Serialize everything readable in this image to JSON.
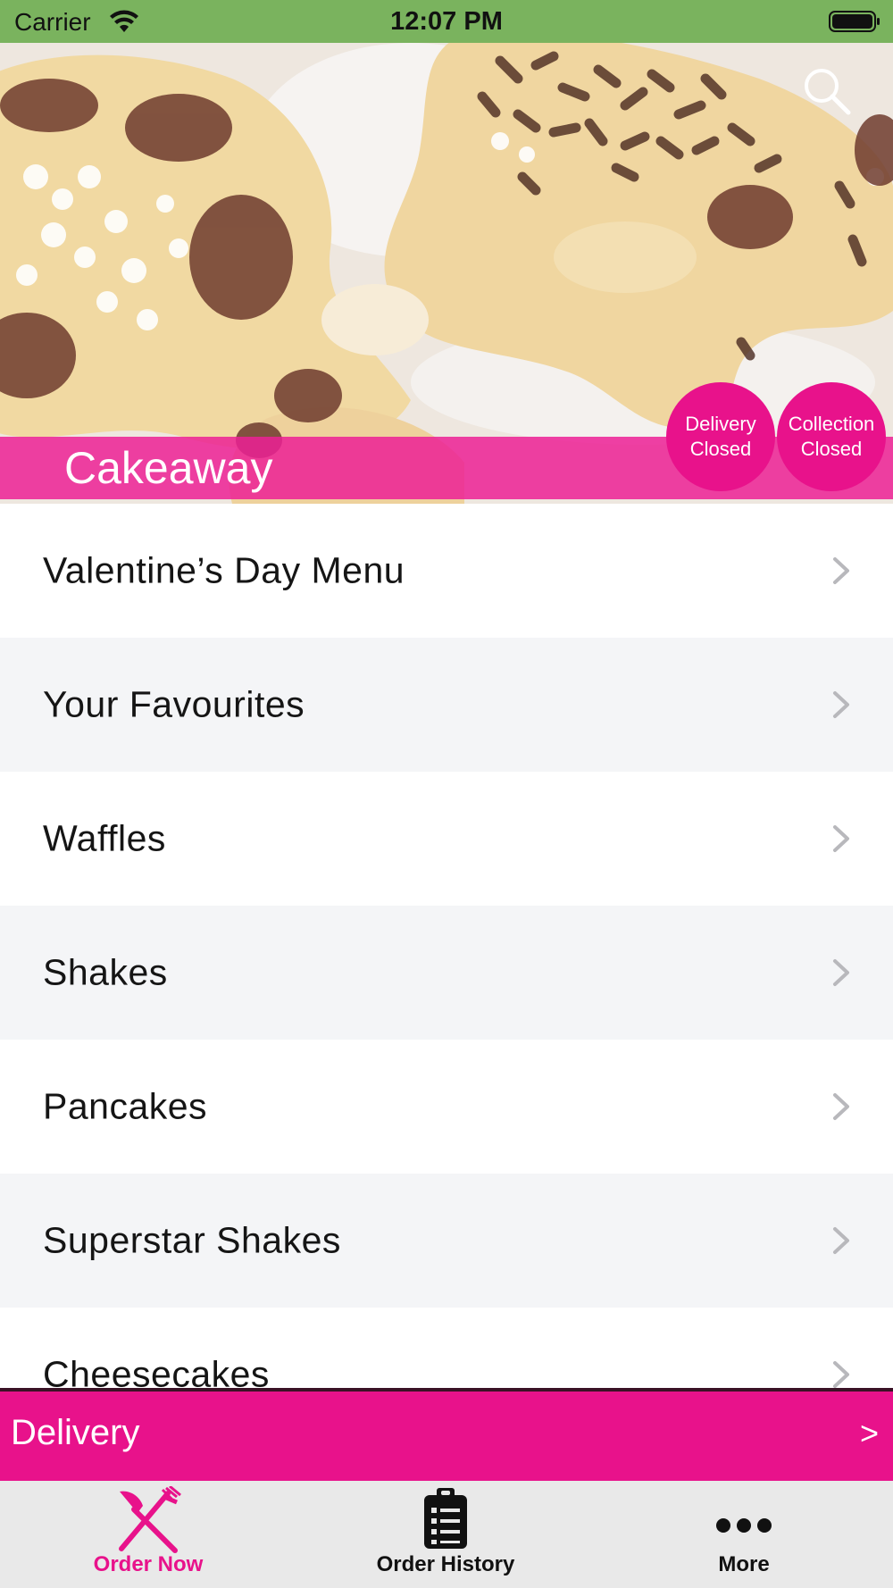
{
  "status_bar": {
    "carrier": "Carrier",
    "time": "12:07 PM"
  },
  "header": {
    "store_name": "Cakeaway",
    "delivery_status": {
      "line1": "Delivery",
      "line2": "Closed"
    },
    "collection_status": {
      "line1": "Collection",
      "line2": "Closed"
    }
  },
  "menu": {
    "items": [
      {
        "label": "Valentine’s Day Menu"
      },
      {
        "label": "Your Favourites"
      },
      {
        "label": "Waffles"
      },
      {
        "label": "Shakes"
      },
      {
        "label": "Pancakes"
      },
      {
        "label": "Superstar Shakes"
      },
      {
        "label": "Cheesecakes"
      }
    ]
  },
  "delivery_bar": {
    "label": "Delivery",
    "arrow": ">"
  },
  "tab_bar": {
    "tabs": [
      {
        "label": "Order Now",
        "icon": "fork-knife-icon",
        "active": true
      },
      {
        "label": "Order History",
        "icon": "clipboard-icon",
        "active": false
      },
      {
        "label": "More",
        "icon": "more-dots-icon",
        "active": false
      }
    ]
  },
  "colors": {
    "accent": "#e8128b",
    "status_bar": "#7ab35e",
    "alt_row": "#f4f5f7",
    "tab_bar": "#e9e9e9"
  }
}
